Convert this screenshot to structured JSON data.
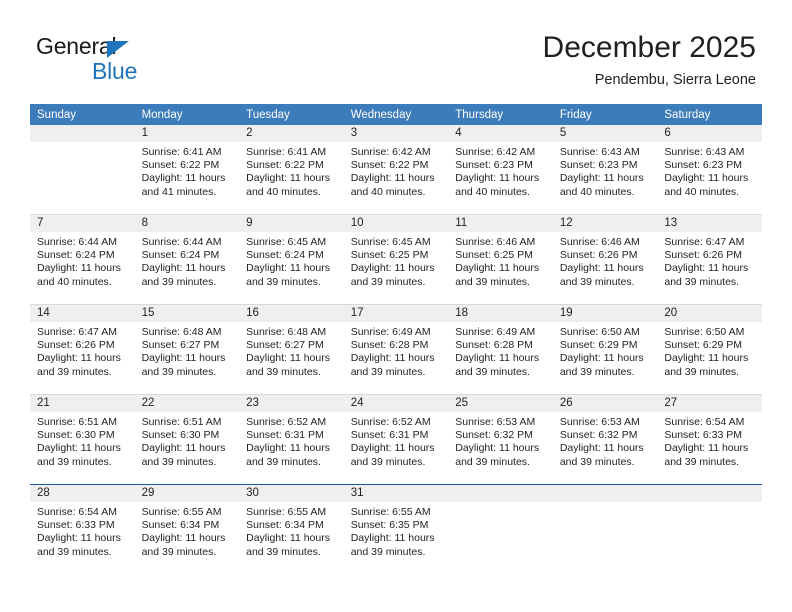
{
  "brand": {
    "name_top": "General",
    "name_bottom": "Blue",
    "accent_color": "#1f74bd"
  },
  "header": {
    "title": "December 2025",
    "location": "Pendembu, Sierra Leone"
  },
  "calendar": {
    "header_bg": "#3d7cba",
    "daynum_bg": "#efefef",
    "weekday_labels": [
      "Sunday",
      "Monday",
      "Tuesday",
      "Wednesday",
      "Thursday",
      "Friday",
      "Saturday"
    ],
    "weeks": [
      [
        {
          "day": "",
          "lines": []
        },
        {
          "day": "1",
          "lines": [
            "Sunrise: 6:41 AM",
            "Sunset: 6:22 PM",
            "Daylight: 11 hours",
            "and 41 minutes."
          ]
        },
        {
          "day": "2",
          "lines": [
            "Sunrise: 6:41 AM",
            "Sunset: 6:22 PM",
            "Daylight: 11 hours",
            "and 40 minutes."
          ]
        },
        {
          "day": "3",
          "lines": [
            "Sunrise: 6:42 AM",
            "Sunset: 6:22 PM",
            "Daylight: 11 hours",
            "and 40 minutes."
          ]
        },
        {
          "day": "4",
          "lines": [
            "Sunrise: 6:42 AM",
            "Sunset: 6:23 PM",
            "Daylight: 11 hours",
            "and 40 minutes."
          ]
        },
        {
          "day": "5",
          "lines": [
            "Sunrise: 6:43 AM",
            "Sunset: 6:23 PM",
            "Daylight: 11 hours",
            "and 40 minutes."
          ]
        },
        {
          "day": "6",
          "lines": [
            "Sunrise: 6:43 AM",
            "Sunset: 6:23 PM",
            "Daylight: 11 hours",
            "and 40 minutes."
          ]
        }
      ],
      [
        {
          "day": "7",
          "lines": [
            "Sunrise: 6:44 AM",
            "Sunset: 6:24 PM",
            "Daylight: 11 hours",
            "and 40 minutes."
          ]
        },
        {
          "day": "8",
          "lines": [
            "Sunrise: 6:44 AM",
            "Sunset: 6:24 PM",
            "Daylight: 11 hours",
            "and 39 minutes."
          ]
        },
        {
          "day": "9",
          "lines": [
            "Sunrise: 6:45 AM",
            "Sunset: 6:24 PM",
            "Daylight: 11 hours",
            "and 39 minutes."
          ]
        },
        {
          "day": "10",
          "lines": [
            "Sunrise: 6:45 AM",
            "Sunset: 6:25 PM",
            "Daylight: 11 hours",
            "and 39 minutes."
          ]
        },
        {
          "day": "11",
          "lines": [
            "Sunrise: 6:46 AM",
            "Sunset: 6:25 PM",
            "Daylight: 11 hours",
            "and 39 minutes."
          ]
        },
        {
          "day": "12",
          "lines": [
            "Sunrise: 6:46 AM",
            "Sunset: 6:26 PM",
            "Daylight: 11 hours",
            "and 39 minutes."
          ]
        },
        {
          "day": "13",
          "lines": [
            "Sunrise: 6:47 AM",
            "Sunset: 6:26 PM",
            "Daylight: 11 hours",
            "and 39 minutes."
          ]
        }
      ],
      [
        {
          "day": "14",
          "lines": [
            "Sunrise: 6:47 AM",
            "Sunset: 6:26 PM",
            "Daylight: 11 hours",
            "and 39 minutes."
          ]
        },
        {
          "day": "15",
          "lines": [
            "Sunrise: 6:48 AM",
            "Sunset: 6:27 PM",
            "Daylight: 11 hours",
            "and 39 minutes."
          ]
        },
        {
          "day": "16",
          "lines": [
            "Sunrise: 6:48 AM",
            "Sunset: 6:27 PM",
            "Daylight: 11 hours",
            "and 39 minutes."
          ]
        },
        {
          "day": "17",
          "lines": [
            "Sunrise: 6:49 AM",
            "Sunset: 6:28 PM",
            "Daylight: 11 hours",
            "and 39 minutes."
          ]
        },
        {
          "day": "18",
          "lines": [
            "Sunrise: 6:49 AM",
            "Sunset: 6:28 PM",
            "Daylight: 11 hours",
            "and 39 minutes."
          ]
        },
        {
          "day": "19",
          "lines": [
            "Sunrise: 6:50 AM",
            "Sunset: 6:29 PM",
            "Daylight: 11 hours",
            "and 39 minutes."
          ]
        },
        {
          "day": "20",
          "lines": [
            "Sunrise: 6:50 AM",
            "Sunset: 6:29 PM",
            "Daylight: 11 hours",
            "and 39 minutes."
          ]
        }
      ],
      [
        {
          "day": "21",
          "lines": [
            "Sunrise: 6:51 AM",
            "Sunset: 6:30 PM",
            "Daylight: 11 hours",
            "and 39 minutes."
          ]
        },
        {
          "day": "22",
          "lines": [
            "Sunrise: 6:51 AM",
            "Sunset: 6:30 PM",
            "Daylight: 11 hours",
            "and 39 minutes."
          ]
        },
        {
          "day": "23",
          "lines": [
            "Sunrise: 6:52 AM",
            "Sunset: 6:31 PM",
            "Daylight: 11 hours",
            "and 39 minutes."
          ]
        },
        {
          "day": "24",
          "lines": [
            "Sunrise: 6:52 AM",
            "Sunset: 6:31 PM",
            "Daylight: 11 hours",
            "and 39 minutes."
          ]
        },
        {
          "day": "25",
          "lines": [
            "Sunrise: 6:53 AM",
            "Sunset: 6:32 PM",
            "Daylight: 11 hours",
            "and 39 minutes."
          ]
        },
        {
          "day": "26",
          "lines": [
            "Sunrise: 6:53 AM",
            "Sunset: 6:32 PM",
            "Daylight: 11 hours",
            "and 39 minutes."
          ]
        },
        {
          "day": "27",
          "lines": [
            "Sunrise: 6:54 AM",
            "Sunset: 6:33 PM",
            "Daylight: 11 hours",
            "and 39 minutes."
          ]
        }
      ],
      [
        {
          "day": "28",
          "lines": [
            "Sunrise: 6:54 AM",
            "Sunset: 6:33 PM",
            "Daylight: 11 hours",
            "and 39 minutes."
          ]
        },
        {
          "day": "29",
          "lines": [
            "Sunrise: 6:55 AM",
            "Sunset: 6:34 PM",
            "Daylight: 11 hours",
            "and 39 minutes."
          ]
        },
        {
          "day": "30",
          "lines": [
            "Sunrise: 6:55 AM",
            "Sunset: 6:34 PM",
            "Daylight: 11 hours",
            "and 39 minutes."
          ]
        },
        {
          "day": "31",
          "lines": [
            "Sunrise: 6:55 AM",
            "Sunset: 6:35 PM",
            "Daylight: 11 hours",
            "and 39 minutes."
          ]
        },
        {
          "day": "",
          "lines": []
        },
        {
          "day": "",
          "lines": []
        },
        {
          "day": "",
          "lines": []
        }
      ]
    ]
  }
}
